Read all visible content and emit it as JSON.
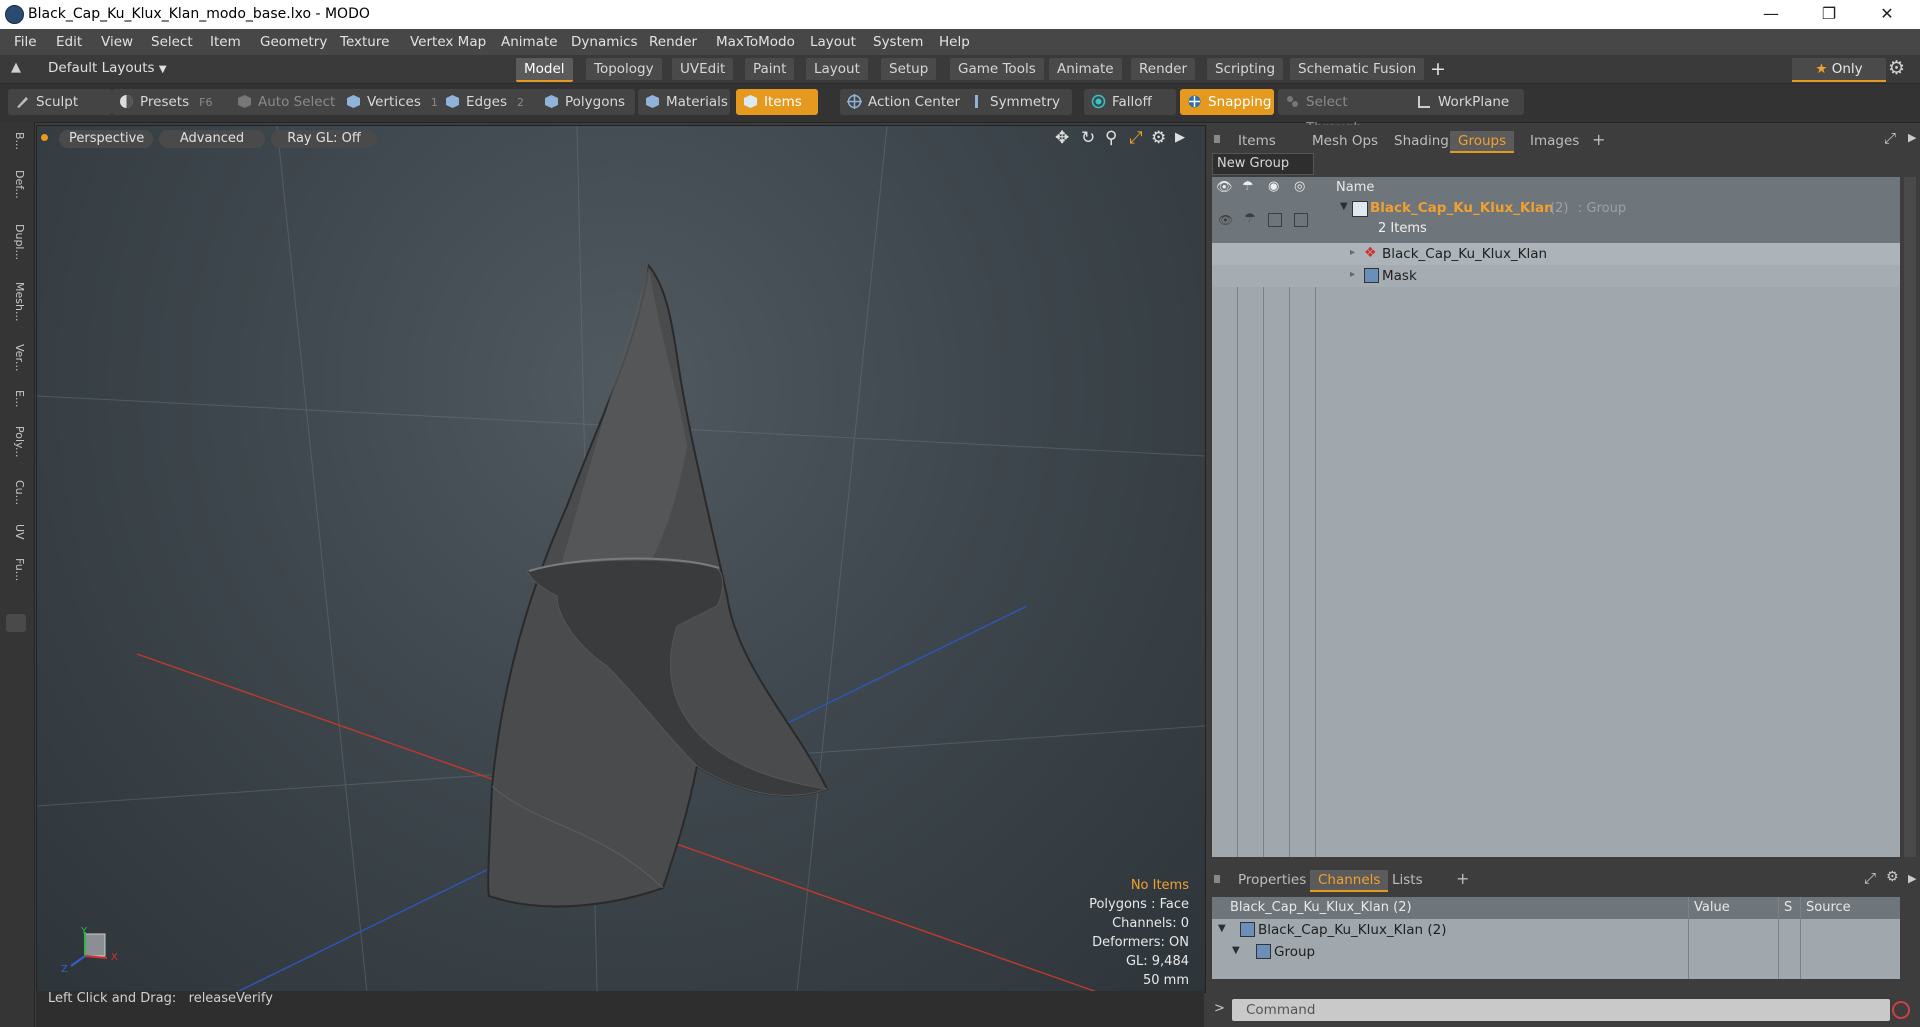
{
  "window": {
    "title": "Black_Cap_Ku_Klux_Klan_modo_base.lxo - MODO"
  },
  "menu": [
    "File",
    "Edit",
    "View",
    "Select",
    "Item",
    "Geometry",
    "Texture",
    "Vertex Map",
    "Animate",
    "Dynamics",
    "Render",
    "MaxToModo",
    "Layout",
    "System",
    "Help"
  ],
  "layouts": {
    "selector": "Default Layouts",
    "tabs": [
      "Model",
      "Topology",
      "UVEdit",
      "Paint",
      "Layout",
      "Setup",
      "Game Tools",
      "Animate",
      "Render",
      "Scripting",
      "Schematic Fusion"
    ],
    "active": "Model",
    "plus": "+",
    "only_label": "Only"
  },
  "toolbar": {
    "sculpt": "Sculpt",
    "presets": "Presets",
    "presets_key": "F6",
    "auto_select": "Auto Select",
    "vertices": "Vertices",
    "vertices_count": "1",
    "edges": "Edges",
    "edges_count": "2",
    "polygons": "Polygons",
    "materials": "Materials",
    "items": "Items",
    "action_center": "Action Center",
    "symmetry": "Symmetry",
    "falloff": "Falloff",
    "snapping": "Snapping",
    "select_through": "Select Through",
    "workplane": "WorkPlane"
  },
  "left_tabs": [
    "B...",
    "Def...",
    "Dupl...",
    "Mesh...",
    "Ver...",
    "E...",
    "Poly...",
    "Cu...",
    "UV",
    "Fu..."
  ],
  "viewport": {
    "perspective": "Perspective",
    "advanced": "Advanced",
    "raygl": "Ray GL: Off",
    "hud": {
      "items": "No Items",
      "polygons": "Polygons : Face",
      "channels": "Channels: 0",
      "deformers": "Deformers: ON",
      "gl": "GL: 9,484",
      "scale": "50 mm"
    },
    "axis_y": "Y",
    "axis_z": "Z",
    "axis_x": "X"
  },
  "status": {
    "text": "Left Click and Drag:   releaseVerify"
  },
  "right": {
    "tabs": [
      "Items",
      "Mesh Ops",
      "Shading",
      "Groups",
      "Images"
    ],
    "active": "Groups",
    "plus": "+",
    "new_group": "New Group",
    "name_header": "Name",
    "group": {
      "name": "Black_Cap_Ku_Klux_Klan",
      "count": "(2)",
      "type": ": Group",
      "items_label": "2 Items"
    },
    "children": [
      "Black_Cap_Ku_Klux_Klan",
      "Mask"
    ],
    "bottom_tabs": [
      "Properties",
      "Channels",
      "Lists"
    ],
    "bottom_active": "Channels",
    "bottom_plus": "+",
    "channels": {
      "header_name": "Black_Cap_Ku_Klux_Klan (2)",
      "header_value": "Value",
      "header_s": "S",
      "header_source": "Source",
      "rows": [
        "Black_Cap_Ku_Klux_Klan (2)",
        "Group"
      ]
    },
    "command_placeholder": "Command"
  },
  "colors": {
    "accent": "#e59a1f",
    "group_name": "#f0a030"
  }
}
